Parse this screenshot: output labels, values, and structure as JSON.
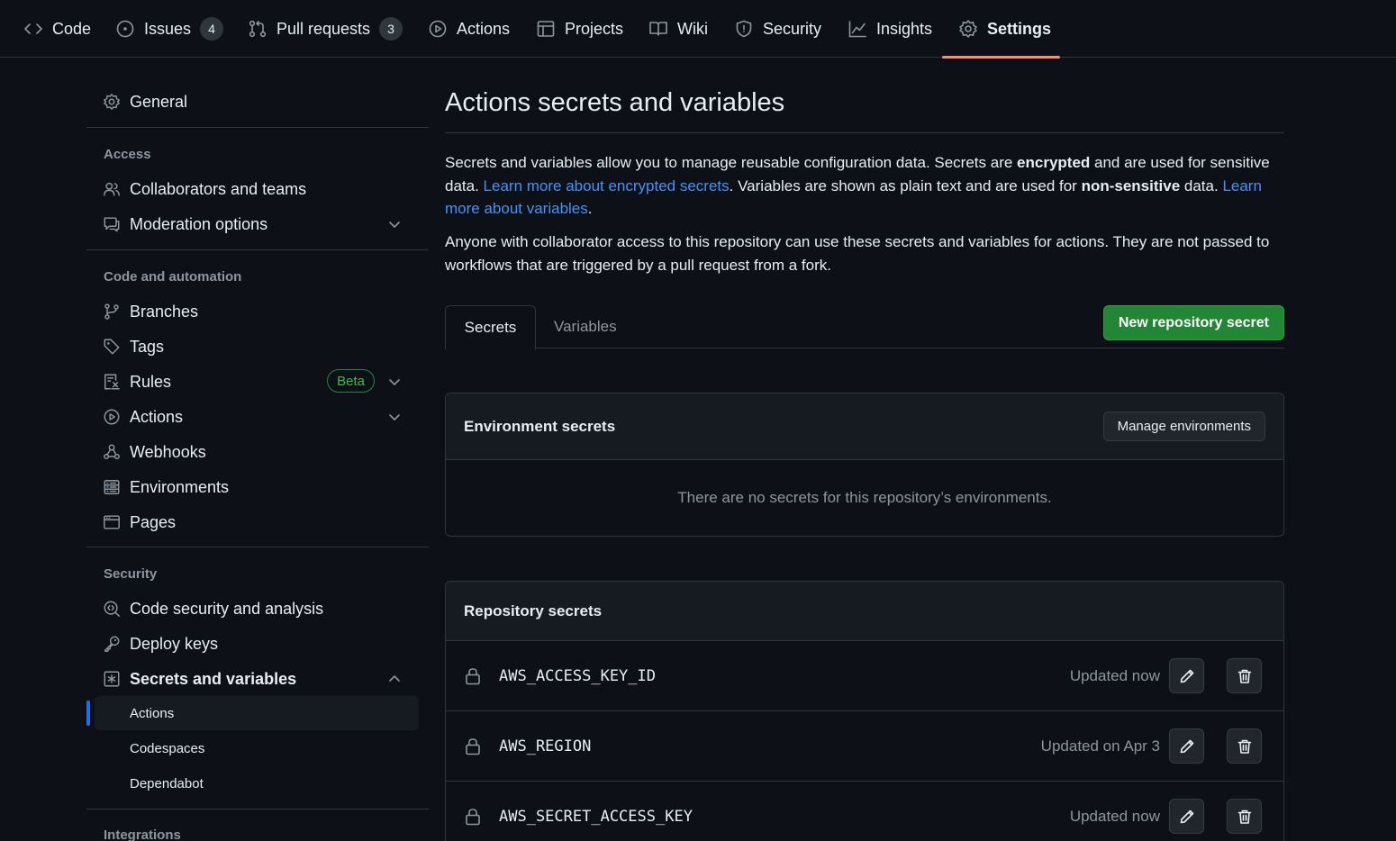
{
  "repo_nav": {
    "tabs": [
      {
        "label": "Code",
        "icon": "code-icon"
      },
      {
        "label": "Issues",
        "icon": "issue-icon",
        "count": "4"
      },
      {
        "label": "Pull requests",
        "icon": "pull-request-icon",
        "count": "3"
      },
      {
        "label": "Actions",
        "icon": "play-icon"
      },
      {
        "label": "Projects",
        "icon": "table-icon"
      },
      {
        "label": "Wiki",
        "icon": "book-icon"
      },
      {
        "label": "Security",
        "icon": "shield-icon"
      },
      {
        "label": "Insights",
        "icon": "graph-icon"
      },
      {
        "label": "Settings",
        "icon": "gear-icon",
        "active": true
      }
    ],
    "active_color": "#fd8c73"
  },
  "sidebar": {
    "general": "General",
    "access": {
      "heading": "Access",
      "items": [
        "Collaborators and teams",
        "Moderation options"
      ]
    },
    "code_automation": {
      "heading": "Code and automation",
      "items": [
        "Branches",
        "Tags",
        "Rules",
        "Actions",
        "Webhooks",
        "Environments",
        "Pages"
      ],
      "rules_badge": "Beta"
    },
    "security": {
      "heading": "Security",
      "items": [
        "Code security and analysis",
        "Deploy keys",
        "Secrets and variables"
      ],
      "sub_items": [
        "Actions",
        "Codespaces",
        "Dependabot"
      ],
      "active_sub_item": "Actions"
    },
    "integrations_heading": "Integrations"
  },
  "main": {
    "title": "Actions secrets and variables",
    "intro": {
      "t1": "Secrets and variables allow you to manage reusable configuration data. Secrets are ",
      "b1": "encrypted",
      "t2": " and are used for sensitive data. ",
      "link1": "Learn more about encrypted secrets",
      "t3": ". Variables are shown as plain text and are used for ",
      "b2": "non-sensitive",
      "t4": " data. ",
      "link2": "Learn more about variables",
      "t5": "."
    },
    "notice": "Anyone with collaborator access to this repository can use these secrets and variables for actions. They are not passed to workflows that are triggered by a pull request from a fork.",
    "tabs": [
      "Secrets",
      "Variables"
    ],
    "active_tab": "Secrets",
    "new_secret_button": "New repository secret",
    "environment_secrets": {
      "title": "Environment secrets",
      "button": "Manage environments",
      "empty": "There are no secrets for this repository’s environments."
    },
    "repository_secrets": {
      "title": "Repository secrets",
      "rows": [
        {
          "name": "AWS_ACCESS_KEY_ID",
          "updated": "Updated now"
        },
        {
          "name": "AWS_REGION",
          "updated": "Updated on Apr 3"
        },
        {
          "name": "AWS_SECRET_ACCESS_KEY",
          "updated": "Updated now"
        }
      ]
    }
  },
  "colors": {
    "background": "#0d1117",
    "primary_button": "#238636",
    "link": "#4493f8",
    "active_indicator": "#1f6feb"
  }
}
